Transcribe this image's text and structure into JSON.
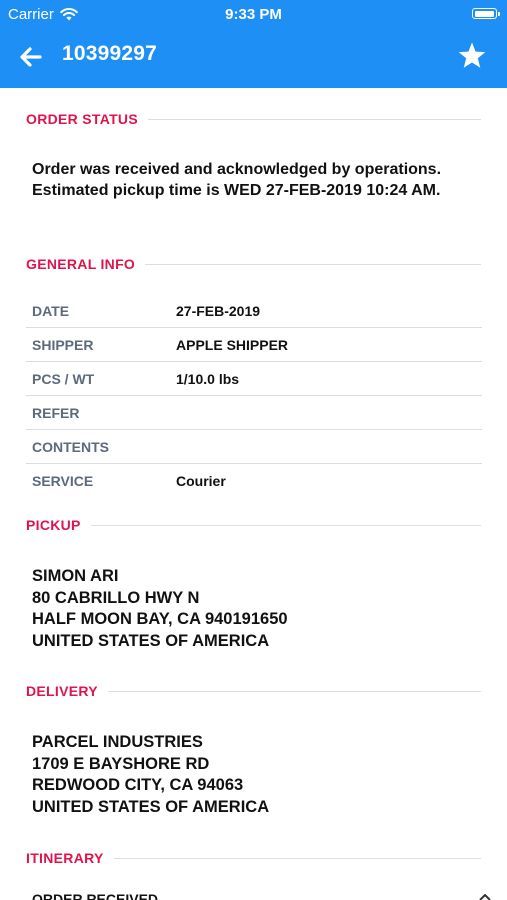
{
  "status_bar": {
    "carrier": "Carrier",
    "time": "9:33 PM"
  },
  "nav": {
    "title": "10399297",
    "back_icon": "arrow-left-icon",
    "favorite_icon": "star-icon"
  },
  "colors": {
    "nav_background": "#1e90f5",
    "section_accent": "#e0144c",
    "label_gray": "#5d6a7c"
  },
  "order_status": {
    "header": "ORDER STATUS",
    "message": "Order was received and acknowledged by operations. Estimated pickup time is WED 27-FEB-2019 10:24 AM."
  },
  "general_info": {
    "header": "GENERAL INFO",
    "rows": [
      {
        "label": "DATE",
        "value": "27-FEB-2019"
      },
      {
        "label": "SHIPPER",
        "value": "APPLE SHIPPER"
      },
      {
        "label": "PCS / WT",
        "value": "1/10.0 lbs"
      },
      {
        "label": "REFER",
        "value": ""
      },
      {
        "label": "CONTENTS",
        "value": ""
      },
      {
        "label": "SERVICE",
        "value": "Courier"
      }
    ]
  },
  "pickup": {
    "header": "PICKUP",
    "lines": [
      "SIMON ARI",
      "80 CABRILLO HWY N",
      "HALF MOON BAY, CA 940191650",
      "UNITED STATES OF AMERICA"
    ]
  },
  "delivery": {
    "header": "DELIVERY",
    "lines": [
      "PARCEL INDUSTRIES",
      "1709 E BAYSHORE RD",
      "REDWOOD CITY, CA 94063",
      "UNITED STATES OF AMERICA"
    ]
  },
  "itinerary": {
    "header": "ITINERARY",
    "first_item": "ORDER RECEIVED"
  }
}
